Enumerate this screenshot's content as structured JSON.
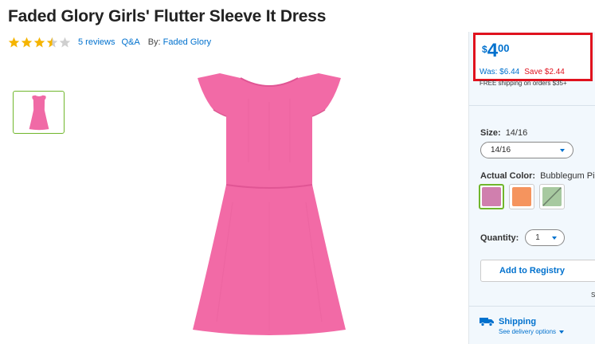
{
  "product": {
    "title": "Faded Glory Girls' Flutter Sleeve It Dress",
    "rating": 3.5,
    "rating_max": 5,
    "reviews_link": "5 reviews",
    "qa_link": "Q&A",
    "by_label": "By:",
    "brand_link": "Faded Glory"
  },
  "price": {
    "currency": "$",
    "whole": "4",
    "cents": "00",
    "was": "Was: $6.44",
    "save": "Save $2.44"
  },
  "shipping_note": "FREE shipping on orders $35+",
  "size": {
    "label": "Size:",
    "value": "14/16",
    "selected": "14/16"
  },
  "color": {
    "label": "Actual Color:",
    "value": "Bubblegum Pink",
    "swatches": [
      {
        "name": "Bubblegum Pink",
        "color": "#d07fae",
        "selected": true
      },
      {
        "name": "Orange",
        "color": "#f5945e",
        "selected": false
      },
      {
        "name": "Green",
        "color": "#a7c9a0",
        "selected": false,
        "unavailable": true
      }
    ]
  },
  "quantity": {
    "label": "Quantity:",
    "value": "1"
  },
  "registry_button": "Add to Registry",
  "side_fragment": "S",
  "shipping": {
    "title": "Shipping",
    "options_link": "See delivery options"
  },
  "colors": {
    "accent": "#0071ce",
    "alert": "#e0121e",
    "selected_border": "#70b62c",
    "star": "#f5b400"
  }
}
